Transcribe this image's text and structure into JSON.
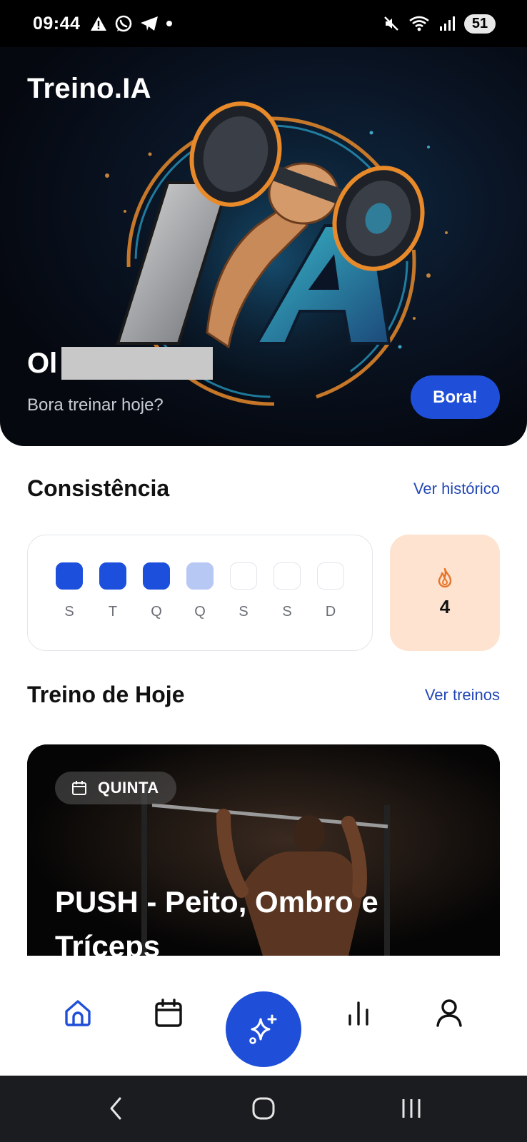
{
  "status_bar": {
    "time": "09:44",
    "battery": "51",
    "left_icons": [
      "warning-icon",
      "whatsapp-icon",
      "telegram-icon",
      "dot-icon"
    ],
    "right_icons": [
      "mute-icon",
      "wifi-icon",
      "signal-icon"
    ]
  },
  "hero": {
    "app_title": "Treino.IA",
    "greeting_prefix": "Ol",
    "subtitle": "Bora treinar hoje?",
    "cta_label": "Bora!"
  },
  "consistency": {
    "title": "Consistência",
    "link": "Ver histórico",
    "days": [
      {
        "label": "S",
        "state": "full"
      },
      {
        "label": "T",
        "state": "full"
      },
      {
        "label": "Q",
        "state": "full"
      },
      {
        "label": "Q",
        "state": "partial"
      },
      {
        "label": "S",
        "state": "empty"
      },
      {
        "label": "S",
        "state": "empty"
      },
      {
        "label": "D",
        "state": "empty"
      }
    ],
    "streak_count": "4",
    "streak_icon": "flame-icon",
    "colors": {
      "full": "#1b4fdc",
      "partial": "#b8c8f5",
      "streak_bg": "#fde3d0",
      "flame": "#e8752a"
    }
  },
  "today": {
    "title": "Treino de Hoje",
    "link": "Ver treinos",
    "day_chip": "QUINTA",
    "workout_title": "PUSH - Peito, Ombro e Tríceps"
  },
  "bottom_nav": {
    "items": [
      "home-icon",
      "calendar-icon",
      "sparkles-icon",
      "stats-icon",
      "profile-icon"
    ],
    "active": "home-icon",
    "accent": "#1f4fd8"
  },
  "system_nav": [
    "back-icon",
    "home-circle-icon",
    "recents-icon"
  ]
}
